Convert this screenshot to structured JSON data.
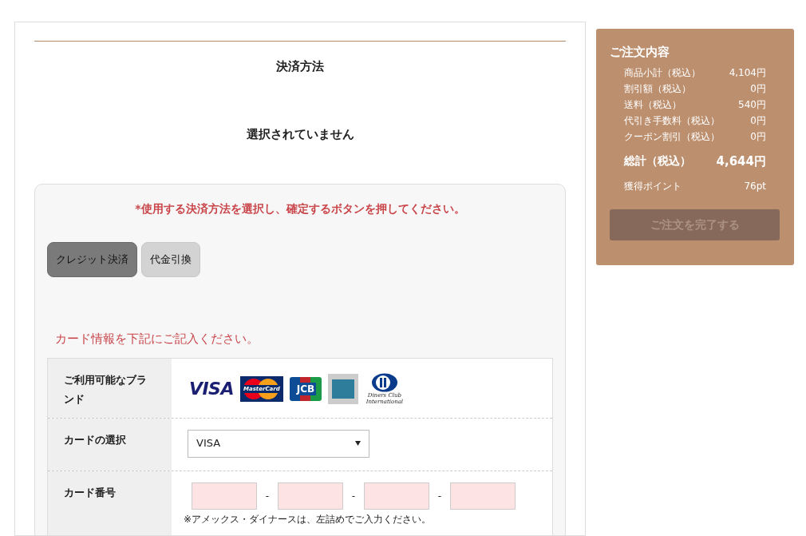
{
  "payment": {
    "title": "決済方法",
    "status": "選択されていません",
    "instruction": "*使用する決済方法を選択し、確定するボタンを押してください。",
    "methods": [
      {
        "label": "クレジット決済",
        "selected": true
      },
      {
        "label": "代金引換",
        "selected": false
      }
    ],
    "card_prompt": "カード情報を下記にご記入ください。",
    "form": {
      "brands_label": "ご利用可能なブランド",
      "brands": [
        {
          "kind": "visa",
          "label": "VISA"
        },
        {
          "kind": "mastercard",
          "label": "MasterCard"
        },
        {
          "kind": "jcb",
          "label": "JCB"
        },
        {
          "kind": "amex"
        },
        {
          "kind": "diners",
          "label": "Diners Club International"
        }
      ],
      "card_select_label": "カードの選択",
      "card_select_value": "VISA",
      "card_number_label": "カード番号",
      "card_number_separators": [
        "-",
        "-",
        "-"
      ],
      "card_number_note": "※アメックス・ダイナースは、左詰めでご入力ください。"
    }
  },
  "summary": {
    "title": "ご注文内容",
    "rows": [
      {
        "label": "商品小計（税込）",
        "value": "4,104円"
      },
      {
        "label": "割引額（税込）",
        "value": "0円"
      },
      {
        "label": "送料（税込）",
        "value": "540円"
      },
      {
        "label": "代引き手数料（税込）",
        "value": "0円"
      },
      {
        "label": "クーポン割引（税込）",
        "value": "0円"
      }
    ],
    "total_label": "総計（税込）",
    "total_value": "4,644円",
    "points_label": "獲得ポイント",
    "points_value": "76pt",
    "complete_button": {
      "label": "ご注文を完了する",
      "disabled": true
    }
  }
}
